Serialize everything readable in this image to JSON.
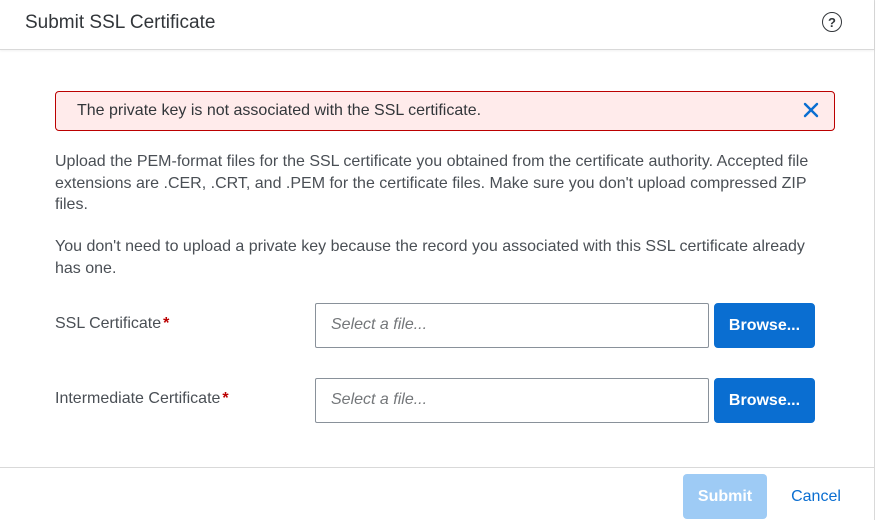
{
  "dialog": {
    "title": "Submit SSL Certificate",
    "help_icon": "help-circle-icon",
    "help_glyph": "?"
  },
  "error": {
    "message": "The private key is not associated with the SSL certificate.",
    "close_icon": "close-icon",
    "border_color": "#bb0000",
    "background_color": "#ffebeb"
  },
  "description": {
    "paragraph1": "Upload the PEM-format files for the SSL certificate you obtained from the certificate authority. Accepted file extensions are .CER, .CRT, and .PEM for the certificate files. Make sure you don't upload compressed ZIP files.",
    "paragraph2": "You don't need to upload a private key because the record you associated with this SSL certificate already has one."
  },
  "form": {
    "ssl_certificate": {
      "label": "SSL Certificate",
      "required_marker": "*",
      "placeholder": "Select a file...",
      "browse_label": "Browse..."
    },
    "intermediate_certificate": {
      "label": "Intermediate Certificate",
      "required_marker": "*",
      "placeholder": "Select a file...",
      "browse_label": "Browse..."
    }
  },
  "footer": {
    "submit_label": "Submit",
    "submit_disabled": true,
    "cancel_label": "Cancel"
  },
  "colors": {
    "accent": "#0a6ed1",
    "accent_disabled": "#9ecbf5",
    "error": "#bb0000"
  }
}
